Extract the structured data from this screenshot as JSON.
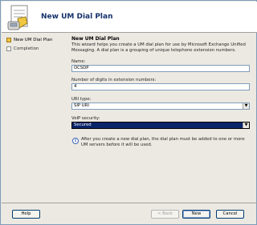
{
  "header": {
    "title": "New UM Dial Plan"
  },
  "steps": [
    {
      "label": "New UM Dial Plan",
      "active": true
    },
    {
      "label": "Completion",
      "active": false
    }
  ],
  "page": {
    "title": "New UM Dial Plan",
    "description": "This wizard helps you create a UM dial plan for use by Microsoft Exchange Unified Messaging. A dial plan is a grouping of unique telephone extension numbers."
  },
  "form": {
    "name_label": "Name:",
    "name_value": "OCSDP",
    "digits_label": "Number of digits in extension numbers:",
    "digits_value": "4",
    "uri_label": "URI type:",
    "uri_value": "SIP URI",
    "voip_label": "VoIP security:",
    "voip_value": "Secured"
  },
  "info": {
    "text": "After you create a new dial plan, the dial plan must be added to one or more UM servers before it will be used."
  },
  "buttons": {
    "help": "Help",
    "back": "< Back",
    "next": "New",
    "cancel": "Cancel"
  }
}
